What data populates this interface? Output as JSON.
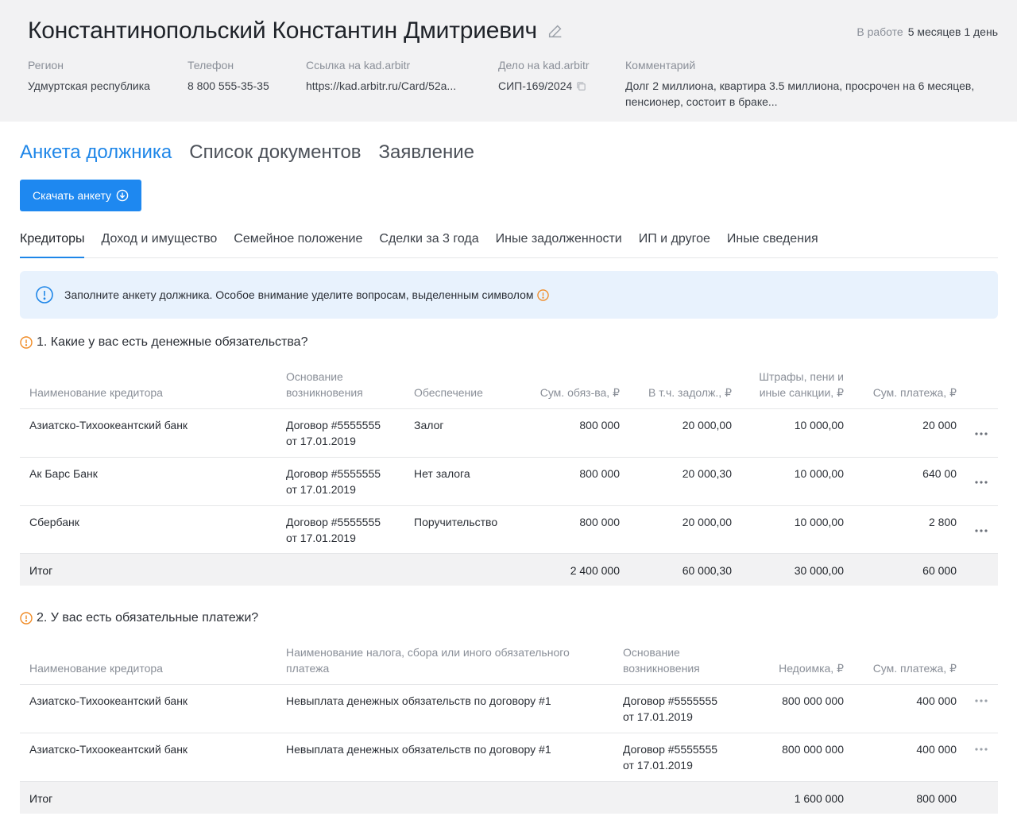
{
  "header": {
    "name": "Константинопольский Константин Дмитриевич",
    "status_label": "В работе",
    "status_value": "5 месяцев 1 день",
    "region_label": "Регион",
    "region_value": "Удмуртская республика",
    "phone_label": "Телефон",
    "phone_value": "8 800 555-35-35",
    "link_label": "Ссылка на kad.arbitr",
    "link_value": "https://kad.arbitr.ru/Card/52a...",
    "case_label": "Дело на  kad.arbitr",
    "case_value": "СИП-169/2024",
    "comment_label": "Комментарий",
    "comment_line1": "Долг 2 миллиона, квартира 3.5 миллиона, просрочен на 6 месяцев,",
    "comment_line2": "пенсионер, состоит в браке..."
  },
  "main_tabs": [
    "Анкета должника",
    "Список документов",
    "Заявление"
  ],
  "download_button": "Скачать анкету",
  "sub_tabs": [
    "Кредиторы",
    "Доход и имущество",
    "Семейное положение",
    "Сделки за 3 года",
    "Иные задолженности",
    "ИП и другое",
    "Иные сведения"
  ],
  "notice": "Заполните анкету должника. Особое внимание уделите вопросам, выделенным символом",
  "q1": {
    "title": "1. Какие у вас есть денежные обязательства?",
    "headers": {
      "creditor": "Наименование кредитора",
      "basis_1": "Основание",
      "basis_2": "возникновения",
      "security": "Обеспечение",
      "sum": "Сум. обяз-ва, ₽",
      "debt": "В т.ч. задолж., ₽",
      "fines_1": "Штрафы, пени и",
      "fines_2": "иные санкции, ₽",
      "payment": "Сум. платежа, ₽"
    },
    "rows": [
      {
        "creditor": "Азиатско-Тихоокеантский банк",
        "basis_1": "Договор #5555555",
        "basis_2": "от 17.01.2019",
        "security": "Залог",
        "sum": "800 000",
        "debt": "20 000,00",
        "fines": "10 000,00",
        "payment": "20 000"
      },
      {
        "creditor": "Ак Барс Банк",
        "basis_1": "Договор #5555555",
        "basis_2": "от 17.01.2019",
        "security": "Нет залога",
        "sum": "800 000",
        "debt": "20 000,30",
        "fines": "10 000,00",
        "payment": "640 00"
      },
      {
        "creditor": "Сбербанк",
        "basis_1": "Договор #5555555",
        "basis_2": "от 17.01.2019",
        "security": "Поручительство",
        "sum": "800 000",
        "debt": "20 000,00",
        "fines": "10 000,00",
        "payment": "2 800"
      }
    ],
    "total": {
      "label": "Итог",
      "sum": "2 400 000",
      "debt": "60 000,30",
      "fines": "30 000,00",
      "payment": "60 000"
    }
  },
  "q2": {
    "title": "2. У вас есть обязательные платежи?",
    "headers": {
      "creditor": "Наименование кредитора",
      "tax_1": "Наименование налога, сбора или иного обязательного",
      "tax_2": "платежа",
      "basis_1": "Основание",
      "basis_2": "возникновения",
      "arrears": "Недоимка, ₽",
      "payment": "Сум. платежа, ₽"
    },
    "rows": [
      {
        "creditor": "Азиатско-Тихоокеантский банк",
        "tax": "Невыплата денежных обязательств по договору #1",
        "basis_1": "Договор #5555555",
        "basis_2": "от 17.01.2019",
        "arrears": "800 000 000",
        "payment": "400 000"
      },
      {
        "creditor": "Азиатско-Тихоокеантский банк",
        "tax": "Невыплата денежных обязательств по договору #1",
        "basis_1": "Договор #5555555",
        "basis_2": "от 17.01.2019",
        "arrears": "800 000 000",
        "payment": "400 000"
      }
    ],
    "total": {
      "label": "Итог",
      "arrears": "1 600 000",
      "payment": "800 000"
    }
  },
  "colors": {
    "accent": "#1e86e8",
    "warning": "#f08a24",
    "header_bg": "#f2f2f3",
    "notice_bg": "#e8f2fd"
  }
}
